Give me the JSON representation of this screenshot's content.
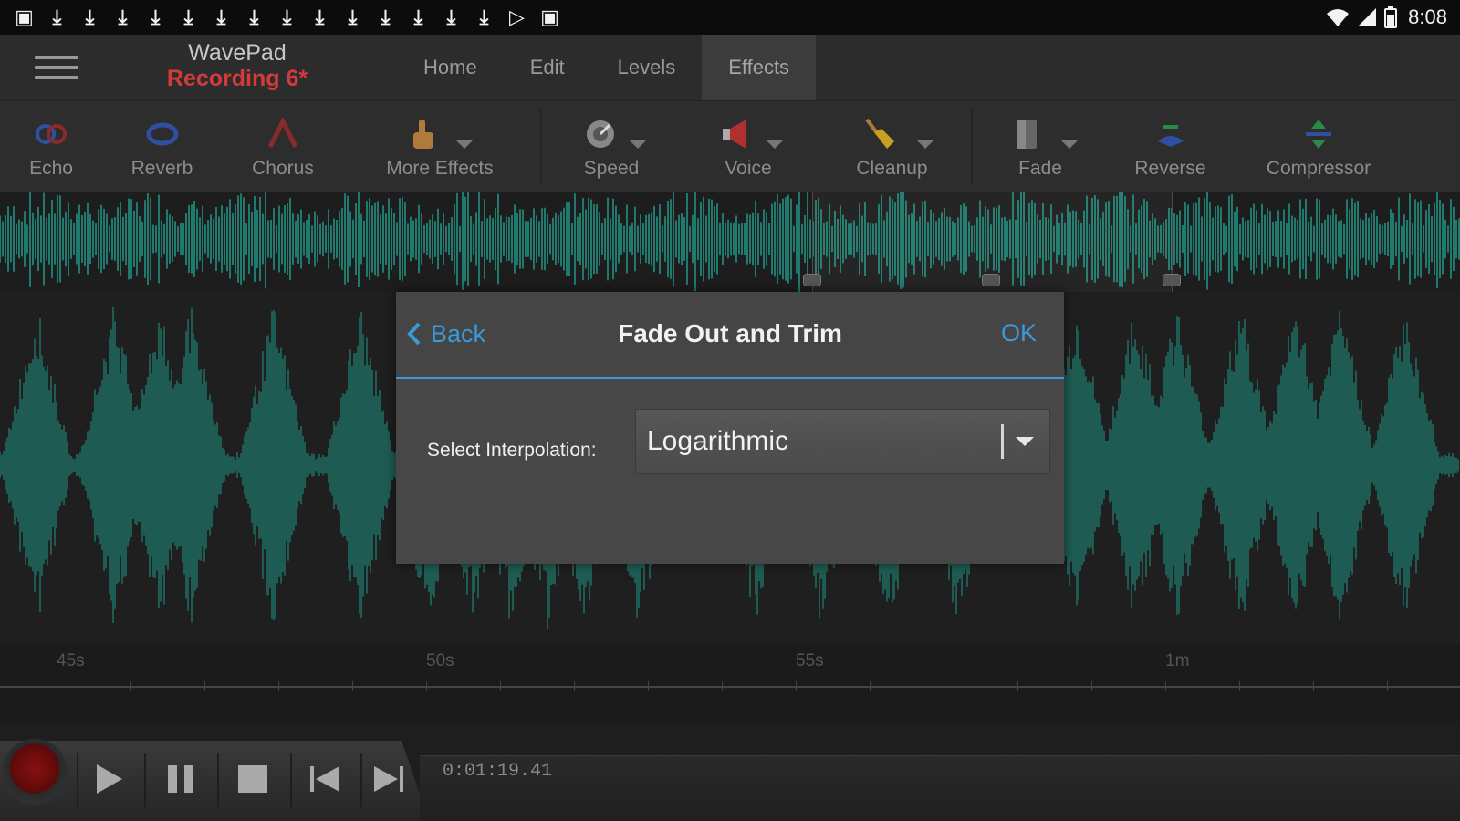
{
  "status_bar": {
    "notification_icons": [
      "image-icon",
      "download-icon",
      "download-icon",
      "download-icon",
      "download-icon",
      "download-icon",
      "download-icon",
      "download-icon",
      "download-icon",
      "download-icon",
      "download-icon",
      "download-icon",
      "download-icon",
      "download-icon",
      "download-icon",
      "play-store-icon",
      "stop-icon"
    ],
    "time": "8:08"
  },
  "app": {
    "name": "WavePad",
    "file": "Recording 6*"
  },
  "tabs": [
    {
      "label": "Home"
    },
    {
      "label": "Edit"
    },
    {
      "label": "Levels"
    },
    {
      "label": "Effects",
      "active": true
    }
  ],
  "toolbar": {
    "items": [
      {
        "label": "Echo",
        "icon": "echo-icon"
      },
      {
        "label": "Reverb",
        "icon": "reverb-icon"
      },
      {
        "label": "Chorus",
        "icon": "chorus-icon"
      },
      {
        "label": "More Effects",
        "icon": "more-effects-icon"
      },
      {
        "label": "Speed",
        "icon": "speed-icon"
      },
      {
        "label": "Voice",
        "icon": "voice-icon"
      },
      {
        "label": "Cleanup",
        "icon": "cleanup-icon"
      },
      {
        "label": "Fade",
        "icon": "fade-icon"
      },
      {
        "label": "Reverse",
        "icon": "reverse-icon"
      },
      {
        "label": "Compressor",
        "icon": "compressor-icon"
      }
    ]
  },
  "timeline": {
    "labels": [
      "45s",
      "50s",
      "55s",
      "1m"
    ]
  },
  "transport": {
    "time": "0:01:19.41"
  },
  "dialog": {
    "back_label": "Back",
    "title": "Fade Out and Trim",
    "ok_label": "OK",
    "interpolation_label": "Select Interpolation:",
    "interpolation_value": "Logarithmic"
  },
  "colors": {
    "accent": "#3a9ad9",
    "waveform": "#1f7a6d",
    "record": "#8a1010",
    "file_name": "#d23b3b"
  }
}
